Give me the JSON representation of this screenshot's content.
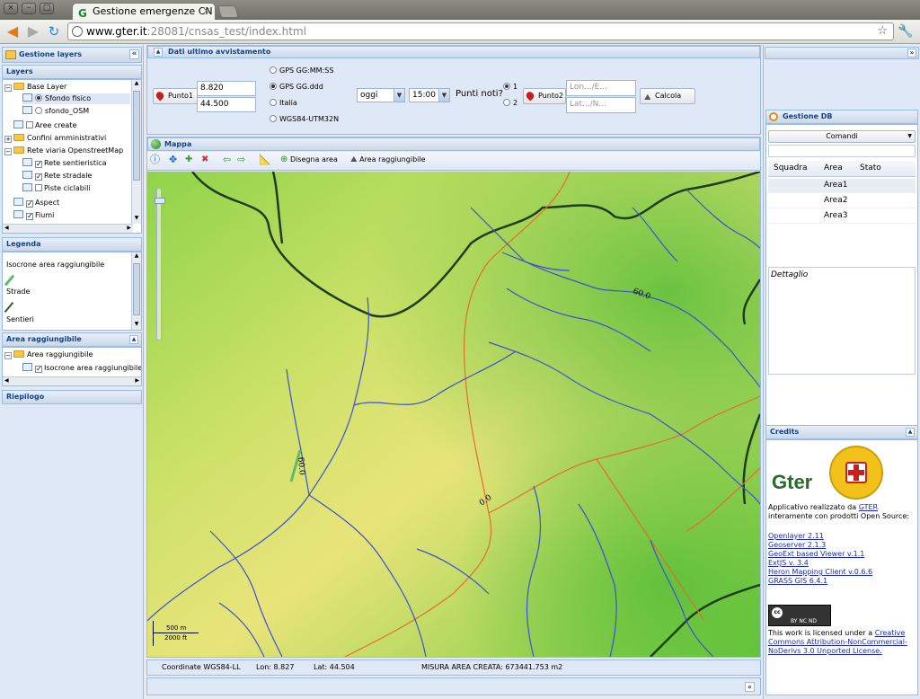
{
  "browser": {
    "tab_title": "Gestione emergenze CN",
    "url_host": "www.gter.it",
    "url_rest": ":28081/cnsas_test/index.html"
  },
  "left": {
    "gestione_layers": "Gestione layers",
    "layers_title": "Layers",
    "tree": [
      {
        "label": "Base Layer",
        "checked": false
      },
      {
        "label": "Sfondo fisico",
        "selected": true
      },
      {
        "label": "sfondo_OSM",
        "selected": false
      },
      {
        "label": "Aree create",
        "checked": false
      },
      {
        "label": "Confini amministrativi"
      },
      {
        "label": "Rete viaria OpenstreetMap"
      },
      {
        "label": "Rete sentieristica",
        "checked": true
      },
      {
        "label": "Rete stradale",
        "checked": true
      },
      {
        "label": "Piste ciclabili",
        "checked": false
      },
      {
        "label": "Aspect",
        "checked": true
      },
      {
        "label": "Fiumi",
        "checked": true
      }
    ],
    "legenda_title": "Legenda",
    "legend_items": [
      {
        "label": "Isocrone area raggiungibile"
      },
      {
        "label": "Strade",
        "color": "#5fba6a"
      },
      {
        "label": "Sentieri",
        "color": "#2d5e2d"
      }
    ],
    "area_title": "Area raggiungibile",
    "area_tree": [
      "Area raggiungibile",
      "Isocrone area raggiungibile"
    ],
    "riepilogo_title": "Riepilogo"
  },
  "avvistamento": {
    "title": "Dati ultimo avvistamento",
    "punto1_label": "Punto1",
    "lon_value": "8.820",
    "lat_value": "44.500",
    "coord_options": [
      "GPS GG:MM:SS",
      "GPS GG.ddd",
      "Italia",
      "WGS84-UTM32N"
    ],
    "coord_selected": 1,
    "date_value": "oggi",
    "time_value": "15:00",
    "punti_noti_label": "Punti noti?",
    "punti_noti_options": [
      "1",
      "2"
    ],
    "punto2_label": "Punto2",
    "lon_placeholder": "Lon.../E...",
    "lat_placeholder": "Lat.../N...",
    "calcola_label": "Calcola"
  },
  "map": {
    "title": "Mappa",
    "disegna_label": "Disegna area",
    "raggiungibile_label": "Area raggiungibile",
    "contour_labels": [
      "60.0",
      "60.0",
      "0.0"
    ],
    "scale_m": "500 m",
    "scale_ft": "2000 ft",
    "colors": {
      "terrain_light": "#e9e77a",
      "terrain_green": "#67c63c",
      "river": "#3f4fd6",
      "road": "#e0702a",
      "boundary": "#1f3d1f"
    }
  },
  "status": {
    "coord_label": "Coordinate WGS84-LL",
    "lon": "Lon: 8.827",
    "lat": "Lat: 44.504",
    "misura": "MISURA AREA CREATA: 673441.753 m2"
  },
  "right": {
    "gestione_db": "Gestione DB",
    "comandi_label": "Comandi",
    "columns": [
      "Squadra",
      "Area",
      "Stato"
    ],
    "rows": [
      [
        "",
        "Area1",
        ""
      ],
      [
        "",
        "Area2",
        ""
      ],
      [
        "",
        "Area3",
        ""
      ]
    ],
    "dettaglio_label": "Dettaglio",
    "credits_title": "Credits",
    "logo_text": "Gter",
    "credits_intro_1": "Applicativo realizzato da ",
    "credits_link_gter": "GTER",
    "credits_intro_2": " interamente con prodotti Open Source:",
    "credits_links": [
      "Openlayer 2.11",
      "Geoserver 2.1.3",
      "GeoExt based Viewer v.1.1",
      "ExtJS v. 3.4",
      "Heron Mapping Client v.0.6.6",
      "GRASS GIS 6.4.1"
    ],
    "cc_badge": "BY NC ND",
    "license_text": "This work is licensed under a ",
    "license_link": "Creative Commons Attribution-NonCommercial-NoDerivs 3.0 Unported License."
  }
}
